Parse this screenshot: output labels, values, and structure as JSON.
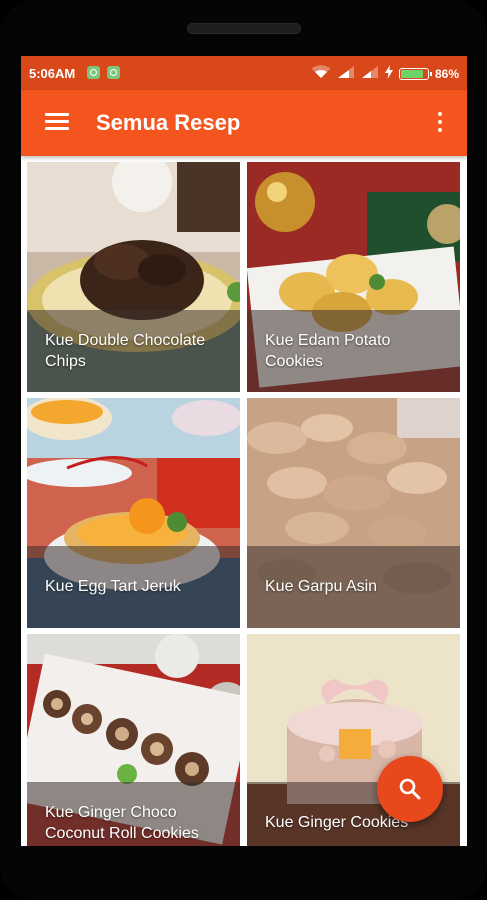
{
  "status_bar": {
    "time": "5:06AM",
    "notifications": [
      "notification-icon",
      "notification-icon"
    ],
    "battery_percent": "86%",
    "battery_level": 0.86,
    "background": "#d9481a"
  },
  "app_bar": {
    "title": "Semua Resep",
    "background": "#f4551e",
    "left_icon": "menu-icon",
    "right_icon": "more-vertical-icon"
  },
  "recipes": [
    {
      "title": "Kue Double Chocolate Chips"
    },
    {
      "title": "Kue Edam Potato Cookies"
    },
    {
      "title": "Kue Egg Tart Jeruk"
    },
    {
      "title": "Kue Garpu Asin"
    },
    {
      "title": "Kue Ginger Choco Coconut Roll Cookies"
    },
    {
      "title": "Kue Ginger Cookies"
    }
  ],
  "fab": {
    "icon": "search-icon",
    "color": "#e8491c"
  }
}
